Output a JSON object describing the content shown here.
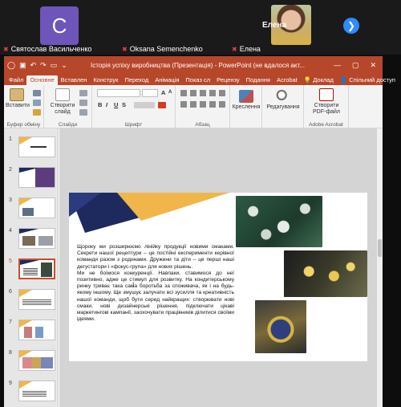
{
  "zoom": {
    "participants": [
      {
        "name": "Святослав Васильченко",
        "initial": "C"
      },
      {
        "name": "Oksana Semenchenko"
      },
      {
        "name": "Елена"
      }
    ],
    "active_speaker_label": "Елена",
    "next_icon": "chevron-right-icon"
  },
  "ppt": {
    "window_title": "Історія успіху виробництва (Презентація) - PowerPoint (не вдалося акт...",
    "window_controls": [
      "—",
      "▢",
      "✕"
    ],
    "tabs": [
      "Файл",
      "Основне",
      "Вставлен",
      "Конструк",
      "Переход",
      "Анімація",
      "Показ сл",
      "Рецензу",
      "Подання",
      "Acrobat"
    ],
    "active_tab": "Основне",
    "tell_me": "Доклад",
    "share": "Спільний доступ",
    "ribbon": {
      "paste": "Вставити",
      "new_slide": "Створити слайд",
      "clipboard_group": "Буфер обміну",
      "slides_group": "Слайди",
      "font_group": "Шрифт",
      "paragraph_group": "Абзац",
      "drawing": "Креслення",
      "editing": "Редагування",
      "create_pdf": "Створити PDF-файл",
      "acrobat_group": "Adobe Acrobat",
      "bold": "B",
      "italic": "I",
      "underline": "U",
      "strike": "S"
    },
    "thumbnails": [
      "1",
      "2",
      "3",
      "4",
      "5",
      "6",
      "7",
      "8",
      "9"
    ],
    "selected_slide": "5",
    "slide_text": [
      "Щороку ми розширюємо лінійку продукції новими смаками. Секрети нашої рецептури – це постійні експерименти керівної команди разом з родинами. Дружини та діти – це перші наші дегустатори і «фокус-група» для нових рішень.",
      "Ми не боїмося конкуренції. Навпаки, ставимося до неї позитивно, адже це стимул для розвитку. На кондитерському ринку триває така сама боротьба за споживача, як і на будь-якому іншому. Ще змушує залучати всі зусилля та креативність нашої команди, щоб бути серед найкращих: створювати нові смаки, нові дизайнерські рішення, підключати цікаві маркетингові кампанії, заохочувати працівників ділитися своїми ідеями."
    ],
    "colors": {
      "brand": "#b7472a",
      "slide_accent": "#f0b64a",
      "slide_navy": "#1e2a5e"
    }
  }
}
